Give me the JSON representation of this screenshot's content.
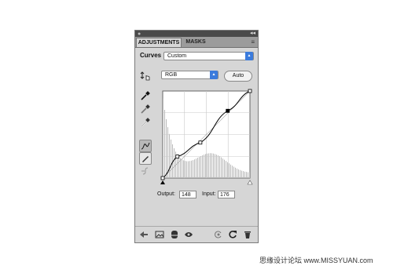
{
  "panel": {
    "tabs": [
      {
        "label": "ADJUSTMENTS"
      },
      {
        "label": "MASKS"
      }
    ],
    "title_controls": {
      "collapse": "◂◂"
    },
    "preset_label": "Curves",
    "preset_value": "Custom",
    "channel_value": "RGB",
    "auto_button": "Auto",
    "output_label": "Output:",
    "output_value": "148",
    "input_label": "Input:",
    "input_value": "176"
  },
  "curve": {
    "points": [
      [
        0,
        0
      ],
      [
        43,
        63
      ],
      [
        110,
        104
      ],
      [
        190,
        197
      ],
      [
        255,
        255
      ]
    ],
    "accent": "#000000",
    "histogram_color": "#b9b9b9",
    "grid_divisions": 4
  },
  "watermark": "思缘设计论坛 www.MISSYUAN.com",
  "colors": {
    "panel_bg": "#d6d6d6",
    "titlebar": "#4a4a4a",
    "dropdown_arrow": "#3b7bdc"
  }
}
